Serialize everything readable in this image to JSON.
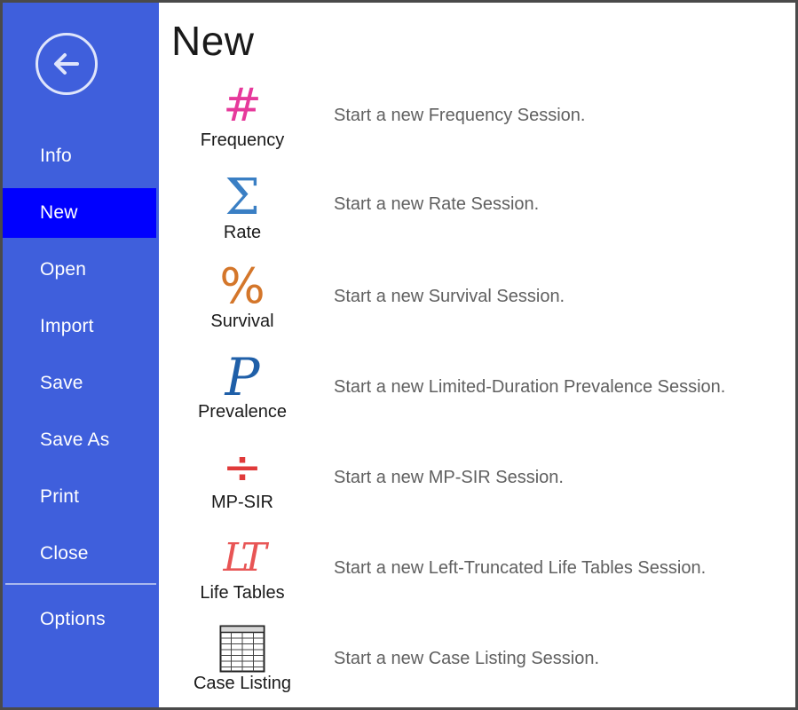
{
  "sidebar": {
    "back_icon": "arrow-left-circle-icon",
    "items": [
      {
        "label": "Info",
        "selected": false
      },
      {
        "label": "New",
        "selected": true
      },
      {
        "label": "Open",
        "selected": false
      },
      {
        "label": "Import",
        "selected": false
      },
      {
        "label": "Save",
        "selected": false
      },
      {
        "label": "Save As",
        "selected": false
      },
      {
        "label": "Print",
        "selected": false
      },
      {
        "label": "Close",
        "selected": false
      },
      {
        "label": "Options",
        "selected": false
      }
    ],
    "bg_color": "#3f5fdc",
    "selected_color": "#0000ff"
  },
  "main": {
    "title": "New",
    "sessions": [
      {
        "label": "Frequency",
        "description": "Start a new Frequency Session.",
        "icon": "hash-icon",
        "glyph": "#",
        "color": "#e6399b"
      },
      {
        "label": "Rate",
        "description": "Start a new Rate Session.",
        "icon": "sigma-icon",
        "glyph": "Σ",
        "color": "#3a7fc4"
      },
      {
        "label": "Survival",
        "description": "Start a new Survival Session.",
        "icon": "percent-icon",
        "glyph": "%",
        "color": "#d4762a"
      },
      {
        "label": "Prevalence",
        "description": "Start a new Limited-Duration Prevalence Session.",
        "icon": "letter-p-icon",
        "glyph": "P",
        "color": "#1f5fa8"
      },
      {
        "label": "MP-SIR",
        "description": "Start a new MP-SIR Session.",
        "icon": "divide-icon",
        "glyph": "÷",
        "color": "#e03a3a"
      },
      {
        "label": "Life Tables",
        "description": "Start a new Left-Truncated Life Tables Session.",
        "icon": "lt-icon",
        "glyph": "LT",
        "color": "#e85555"
      },
      {
        "label": "Case Listing",
        "description": "Start a new Case Listing Session.",
        "icon": "table-grid-icon",
        "glyph": "",
        "color": "#222222"
      }
    ]
  }
}
